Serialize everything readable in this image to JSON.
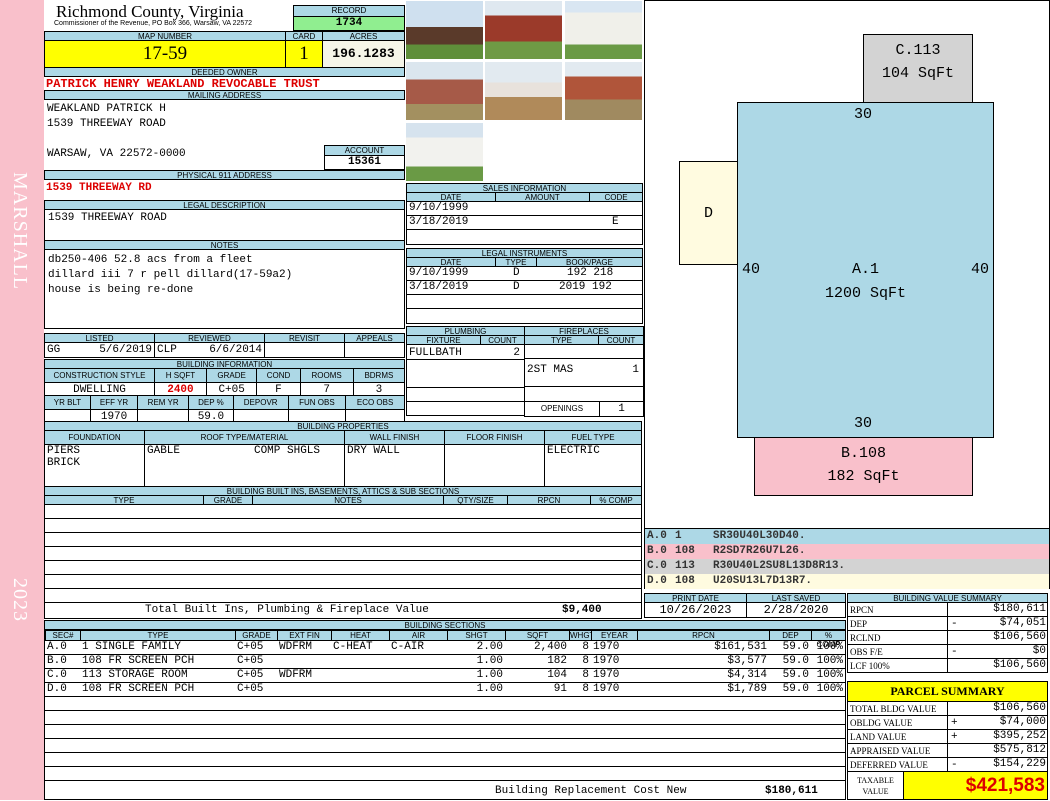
{
  "side": {
    "name": "MARSHALL",
    "year": "2023"
  },
  "header": {
    "county": "Richmond County, Virginia",
    "sub": "Commissioner of the Revenue, PO Box 366, Warsaw, VA 22572",
    "record_label": "RECORD",
    "record": "1734"
  },
  "parcel": {
    "map_label": "MAP NUMBER",
    "map": "17-59",
    "card_label": "CARD",
    "card": "1",
    "acres_label": "ACRES",
    "acres": "196.1283"
  },
  "owner": {
    "label": "DEEDED OWNER",
    "value": "PATRICK HENRY WEAKLAND REVOCABLE TRUST"
  },
  "mailing": {
    "label": "MAILING ADDRESS",
    "line1": "WEAKLAND PATRICK H",
    "line2": "1539 THREEWAY ROAD",
    "line3": "WARSAW, VA 22572-0000",
    "account_label": "ACCOUNT",
    "account": "15361"
  },
  "physical": {
    "label": "PHYSICAL 911 ADDRESS",
    "value": "1539 THREEWAY RD"
  },
  "legal": {
    "label": "LEGAL DESCRIPTION",
    "value": "1539 THREEWAY ROAD"
  },
  "notes": {
    "label": "NOTES",
    "lines": [
      "db250-406 52.8 acs from a fleet",
      "dillard iii 7 r pell dillard(17-59a2)",
      "house is being re-done"
    ]
  },
  "sales": {
    "label": "SALES INFORMATION",
    "headers": [
      "DATE",
      "AMOUNT",
      "CODE"
    ],
    "rows": [
      [
        "9/10/1999",
        "",
        ""
      ],
      [
        "3/18/2019",
        "",
        "E"
      ]
    ]
  },
  "instruments": {
    "label": "LEGAL INSTRUMENTS",
    "headers": [
      "DATE",
      "TYPE",
      "BOOK/PAGE"
    ],
    "rows": [
      [
        "9/10/1999",
        "D",
        "192 218"
      ],
      [
        "3/18/2019",
        "D",
        "2019 192"
      ]
    ]
  },
  "review": {
    "headers": [
      "LISTED",
      "REVIEWED",
      "REVISIT",
      "APPEALS"
    ],
    "listed_by": "GG",
    "listed": "5/6/2019",
    "reviewed_by": "CLP",
    "reviewed": "6/6/2014"
  },
  "bldg_info": {
    "label": "BUILDING INFORMATION",
    "h1": [
      "CONSTRUCTION STYLE",
      "H SQFT",
      "GRADE",
      "COND",
      "ROOMS",
      "BDRMS"
    ],
    "v1": [
      "DWELLING",
      "2400",
      "C+05",
      "F",
      "7",
      "3"
    ],
    "h2": [
      "YR BLT",
      "EFF YR",
      "REM YR",
      "DEP %",
      "DEPOVR",
      "FUN OBS",
      "ECO OBS"
    ],
    "v2": [
      "",
      "1970",
      "",
      "59.0",
      "",
      "",
      ""
    ]
  },
  "plumbing": {
    "label": "PLUMBING",
    "headers": [
      "FIXTURE",
      "COUNT"
    ],
    "fixture": "FULLBATH",
    "count": "2"
  },
  "fireplaces": {
    "label": "FIREPLACES",
    "headers": [
      "TYPE",
      "COUNT"
    ],
    "type": "2ST MAS",
    "count": "1",
    "openings_label": "OPENINGS",
    "openings": "1"
  },
  "props": {
    "label": "BUILDING PROPERTIES",
    "headers": [
      "FOUNDATION",
      "ROOF TYPE/MATERIAL",
      "WALL FINISH",
      "FLOOR FINISH",
      "FUEL TYPE"
    ],
    "foundation1": "PIERS",
    "foundation2": "BRICK",
    "roof": "GABLE",
    "roof_mat": "COMP SHGLS",
    "wall": "DRY WALL",
    "floor": "",
    "fuel": "ELECTRIC"
  },
  "builtins": {
    "label": "BUILDING BUILT INS, BASEMENTS, ATTICS & SUB SECTIONS",
    "headers": [
      "TYPE",
      "GRADE",
      "NOTES",
      "QTY/SIZE",
      "RPCN",
      "% COMP"
    ],
    "total_label": "Total Built Ins, Plumbing & Fireplace Value",
    "total": "$9,400"
  },
  "dates": {
    "print_label": "PRINT DATE",
    "print": "10/26/2023",
    "saved_label": "LAST SAVED",
    "saved": "2/28/2020"
  },
  "sections": {
    "label": "BUILDING SECTIONS",
    "headers": [
      "SEC#",
      "TYPE",
      "GRADE",
      "EXT FIN",
      "HEAT",
      "AIR",
      "SHGT",
      "SQFT",
      "WHGT",
      "EYEAR",
      "RPCN",
      "DEP",
      "% COMP"
    ],
    "rows": [
      [
        "A.0",
        "1 SINGLE FAMILY",
        "C+05",
        "WDFRM",
        "C-HEAT",
        "C-AIR",
        "2.00",
        "2,400",
        "8",
        "1970",
        "$161,531",
        "59.0",
        "100%"
      ],
      [
        "B.0",
        "108 FR SCREEN PCH",
        "C+05",
        "",
        "",
        "",
        "1.00",
        "182",
        "8",
        "1970",
        "$3,577",
        "59.0",
        "100%"
      ],
      [
        "C.0",
        "113 STORAGE ROOM",
        "C+05",
        "WDFRM",
        "",
        "",
        "1.00",
        "104",
        "8",
        "1970",
        "$4,314",
        "59.0",
        "100%"
      ],
      [
        "D.0",
        "108 FR SCREEN PCH",
        "C+05",
        "",
        "",
        "",
        "1.00",
        "91",
        "8",
        "1970",
        "$1,789",
        "59.0",
        "100%"
      ]
    ],
    "total_label": "Building Replacement Cost New",
    "total": "$180,611"
  },
  "sketch": {
    "a_label": "A.1",
    "a_area": "1200 SqFt",
    "a_top": "30",
    "a_bottom": "30",
    "a_left": "40",
    "a_right": "40",
    "b_label": "B.108",
    "b_area": "182 SqFt",
    "c_label": "C.113",
    "c_area": "104 SqFt",
    "d_label": "D",
    "codes": [
      [
        "A.0",
        "1",
        "SR30U40L30D40."
      ],
      [
        "B.0",
        "108",
        "R2SD7R26U7L26."
      ],
      [
        "C.0",
        "113",
        "R30U40L2SU8L13D8R13."
      ],
      [
        "D.0",
        "108",
        "U20SU13L7D13R7."
      ]
    ],
    "colors": [
      "#add8e6",
      "#f9c0cb",
      "#d3d3d3",
      "#fffbe0"
    ]
  },
  "value_summary": {
    "label": "BUILDING VALUE SUMMARY",
    "rows": [
      [
        "RPCN",
        "",
        "$180,611"
      ],
      [
        "DEP",
        "-",
        "$74,051"
      ],
      [
        "RCLND",
        "",
        "$106,560"
      ],
      [
        "OBS F/E",
        "-",
        "$0"
      ],
      [
        "LCF  100%",
        "",
        "$106,560"
      ]
    ]
  },
  "parcel_summary": {
    "label": "PARCEL SUMMARY",
    "rows": [
      [
        "TOTAL BLDG VALUE",
        "",
        "$106,560"
      ],
      [
        "OBLDG VALUE",
        "+",
        "$74,000"
      ],
      [
        "LAND VALUE",
        "+",
        "$395,252"
      ],
      [
        "APPRAISED VALUE",
        "",
        "$575,812"
      ],
      [
        "DEFERRED VALUE",
        "-",
        "$154,229"
      ]
    ],
    "taxable_label1": "TAXABLE",
    "taxable_label2": "VALUE",
    "taxable": "$421,583"
  }
}
